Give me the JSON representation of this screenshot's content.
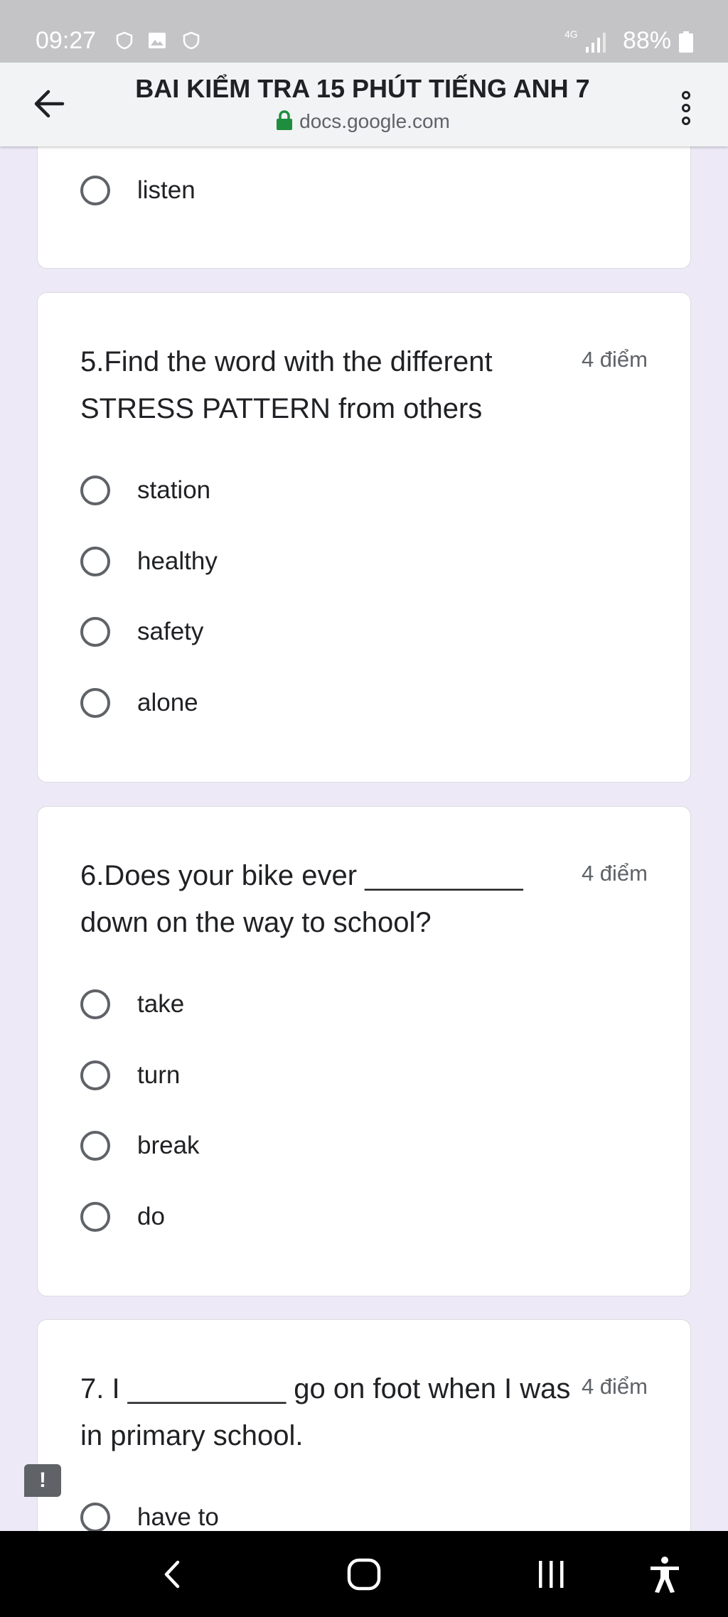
{
  "status_bar": {
    "time": "09:27",
    "network": "4G",
    "battery": "88%",
    "icons": [
      "shield-icon",
      "image-icon",
      "shield-icon",
      "signal-icon",
      "battery-icon"
    ]
  },
  "browser": {
    "title": "BAI KIỂM TRA 15 PHÚT TIẾNG ANH 7",
    "url": "docs.google.com",
    "back_icon": "arrow-back-icon",
    "menu_icon": "more-vert-icon",
    "lock_icon": "lock-icon",
    "lock_color": "#1e8e3e"
  },
  "questions": [
    {
      "title": "",
      "points": "",
      "options": [
        "listen"
      ]
    },
    {
      "title": "5.Find the word with the different STRESS PATTERN from others",
      "points": "4 điểm",
      "options": [
        "station",
        "healthy",
        "safety",
        "alone"
      ]
    },
    {
      "title": "6.Does your bike ever __________ down on the way to school?",
      "points": "4 điểm",
      "options": [
        "take",
        "turn",
        "break",
        "do"
      ]
    },
    {
      "title": "7. I __________ go on foot when I was in primary school.",
      "points": "4 điểm",
      "options": [
        "have to"
      ]
    }
  ],
  "feedback": {
    "label": "!"
  },
  "nav_bar": {
    "icons": [
      "nav-back-icon",
      "nav-home-icon",
      "nav-recents-icon",
      "accessibility-icon"
    ]
  },
  "colors": {
    "page_background": "#ede9f6",
    "card_background": "#ffffff",
    "status_bar": "#c4c4c6",
    "header": "#f1f3f4"
  }
}
